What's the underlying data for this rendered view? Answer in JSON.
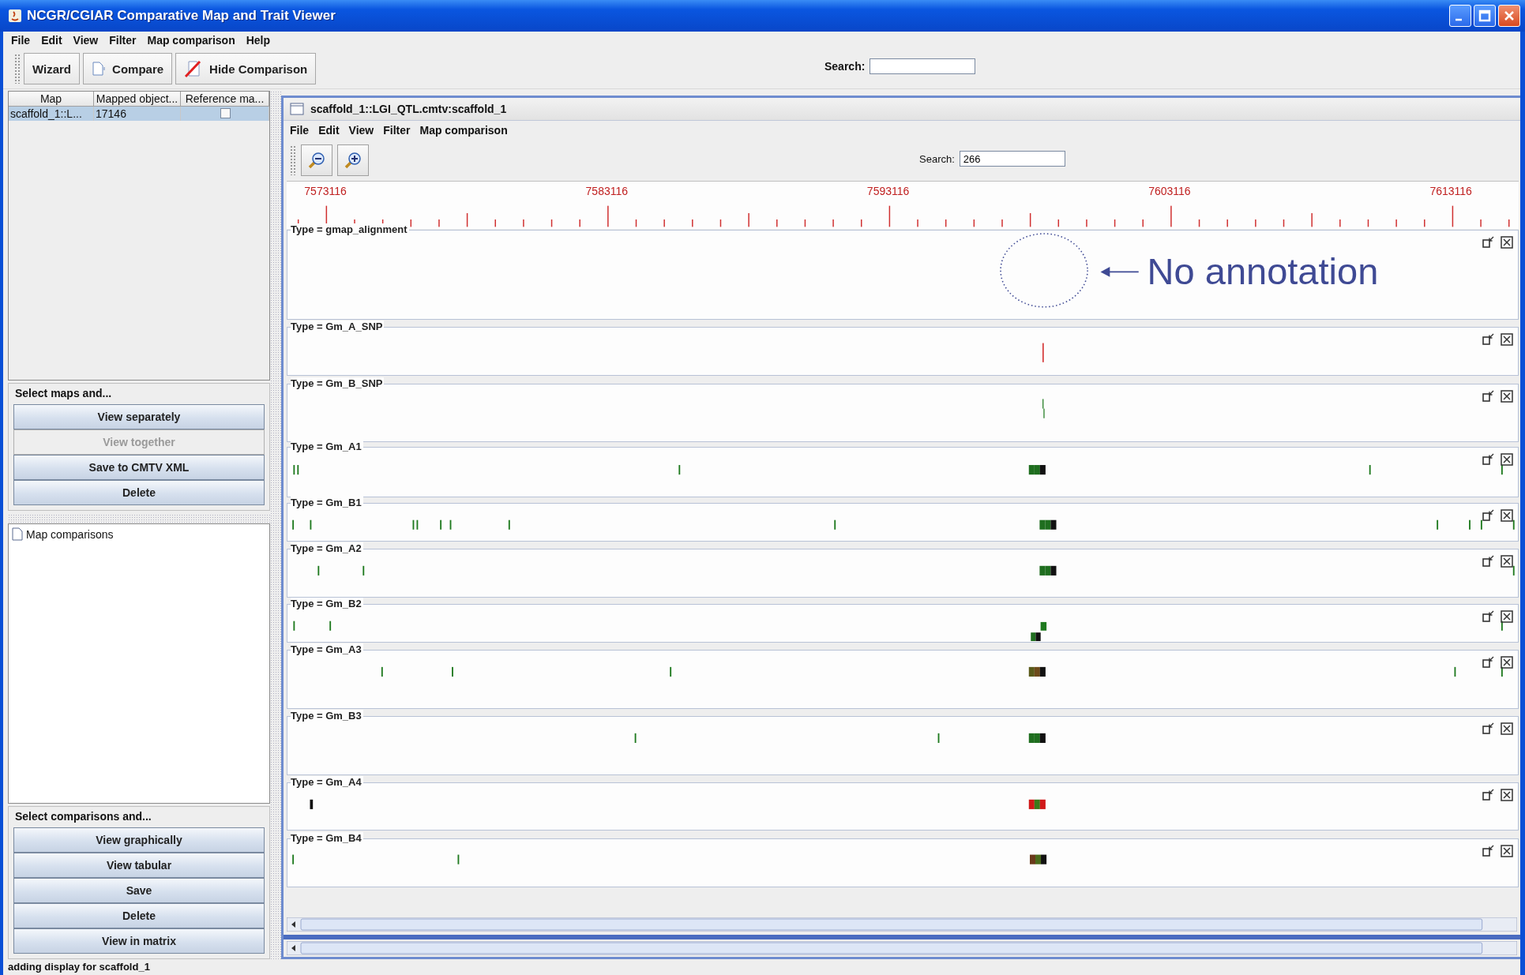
{
  "window": {
    "title": "NCGR/CGIAR Comparative Map and Trait Viewer"
  },
  "menu": [
    "File",
    "Edit",
    "View",
    "Filter",
    "Map comparison",
    "Help"
  ],
  "toolbar": {
    "buttons": [
      {
        "label": "Wizard",
        "kind": "text"
      },
      {
        "label": "Compare",
        "kind": "compare"
      },
      {
        "label": "Hide Comparison",
        "kind": "hide"
      }
    ],
    "search": {
      "label": "Search:"
    }
  },
  "maps_table": {
    "columns": [
      "Map",
      "Mapped object...",
      "Reference ma..."
    ],
    "rows": [
      {
        "cells": [
          "scaffold_1::L...",
          "17146"
        ],
        "checked": false,
        "selected": true
      }
    ]
  },
  "map_actions": {
    "title": "Select maps and...",
    "buttons": [
      {
        "label": "View separately",
        "disabled": false
      },
      {
        "label": "View together",
        "disabled": true
      },
      {
        "label": "Save to CMTV XML",
        "disabled": false
      },
      {
        "label": "Delete",
        "disabled": false
      }
    ]
  },
  "comparisons_tree": {
    "items": [
      {
        "label": "Map comparisons"
      }
    ]
  },
  "comparison_actions": {
    "title": "Select comparisons and...",
    "buttons": [
      {
        "label": "View graphically",
        "disabled": false
      },
      {
        "label": "View tabular",
        "disabled": false
      },
      {
        "label": "Save",
        "disabled": false
      },
      {
        "label": "Delete",
        "disabled": false
      },
      {
        "label": "View in matrix",
        "disabled": false
      }
    ]
  },
  "map_window": {
    "title": "scaffold_1::LGI_QTL.cmtv:scaffold_1",
    "menu": [
      "File",
      "Edit",
      "View",
      "Filter",
      "Map comparison"
    ],
    "search": {
      "label": "Search:",
      "value": "266"
    },
    "ruler": {
      "labels": [
        "7573116",
        "7583116",
        "7593116",
        "7603116",
        "7613116"
      ]
    },
    "tracks": [
      {
        "label": "Type = gmap_alignment",
        "annotation": "No annotation"
      },
      {
        "label": "Type = Gm_A_SNP"
      },
      {
        "label": "Type = Gm_B_SNP"
      },
      {
        "label": "Type = Gm_A1"
      },
      {
        "label": "Type = Gm_B1"
      },
      {
        "label": "Type = Gm_A2"
      },
      {
        "label": "Type = Gm_B2"
      },
      {
        "label": "Type = Gm_A3"
      },
      {
        "label": "Type = Gm_B3"
      },
      {
        "label": "Type = Gm_A4"
      },
      {
        "label": "Type = Gm_B4"
      }
    ]
  },
  "status_bar": "adding display for scaffold_1"
}
